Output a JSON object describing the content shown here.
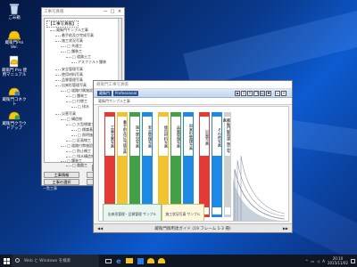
{
  "desktop": {
    "icons": [
      {
        "label": "ごみ箱",
        "icon": "recycle-bin-icon"
      },
      {
        "label": "蔵衛門Pro Ver.",
        "icon": "kuraemon-helmet-icon"
      },
      {
        "label": "蔵衛門 Pro 使用マニュアル",
        "icon": "manual-helmet-icon"
      },
      {
        "label": "蔵衛門コネクト",
        "icon": "kuraemon-connect-icon"
      },
      {
        "label": "蔵衛門クラウドアップ",
        "icon": "cloud-up-icon"
      }
    ]
  },
  "tree_window": {
    "title": "工事写真帳",
    "minimize": "—",
    "maximize": "□",
    "close": "×",
    "root_label": "【工事写真帳】",
    "items": [
      "蔵衛門サンプル工事",
      "着手前及び完成写真",
      "施工状況写真",
      "□ 共通工",
      "□ 舗装工",
      "□ 道路土工",
      "アスファルト舗装",
      "安全管理写真",
      "使用材料写真",
      "品質管理写真",
      "出来形管理写真",
      "□ 道路付属施設工",
      "□ 舗装工",
      "□ 付帯工",
      "□ 排水",
      "災害写真",
      "□ 構造物",
      "□ 大型標識工",
      "□ 標識基礎",
      "□ 照明施設",
      "□ 区画線工",
      "□ 道路付帯施設工",
      "□ 防止柵工",
      "□ 排水構造物",
      "□ 舗装工",
      "□ 路盤工"
    ],
    "buttons": {
      "row1_right": "工事設定",
      "construction_info": "工事情報",
      "edit_properties": "属性変更",
      "select_construction": "工事の選択",
      "display_switch": "表示の切替"
    },
    "status": "一覧工事"
  },
  "main_window": {
    "title": "蔵衛門工事写真帳",
    "toolbar_badge_name": "蔵衛門",
    "toolbar_badge_edition": "Professional",
    "info_text": "蔵衛門サンプル工事",
    "binders": [
      {
        "label": "工事全景写真",
        "color": "#e53935"
      },
      {
        "label": "着手前及び完成写真",
        "color": "#f2c230"
      },
      {
        "label": "施工状況写真",
        "color": "#43a047"
      },
      {
        "label": "安全管理写真",
        "color": "#1e88e5"
      },
      {
        "label": "使用材料写真",
        "color": "#f2c230"
      },
      {
        "label": "品質管理写真",
        "color": "#43a047"
      },
      {
        "label": "出来形管理写真",
        "color": "#1e88e5"
      },
      {
        "label": "災害写真",
        "color": "#e53935"
      },
      {
        "label": "その他写真",
        "color": "#1e88e5"
      },
      {
        "label": "蔵衛門御用達 施工写真",
        "color": "#d0d0d0"
      }
    ],
    "cover_left": "出来形管理・品質管理 サンプル",
    "cover_right": "施工状況写真 サンプル",
    "footer": "蔵衛門御用達ガイド (19 フレーム 1-3 冊)",
    "nav_prev": "◀◀",
    "nav_next": "▶▶"
  },
  "taskbar": {
    "search_placeholder": "Web と Windows を検索",
    "time": "20:10",
    "date": "2015/11/02",
    "ime": "A"
  }
}
